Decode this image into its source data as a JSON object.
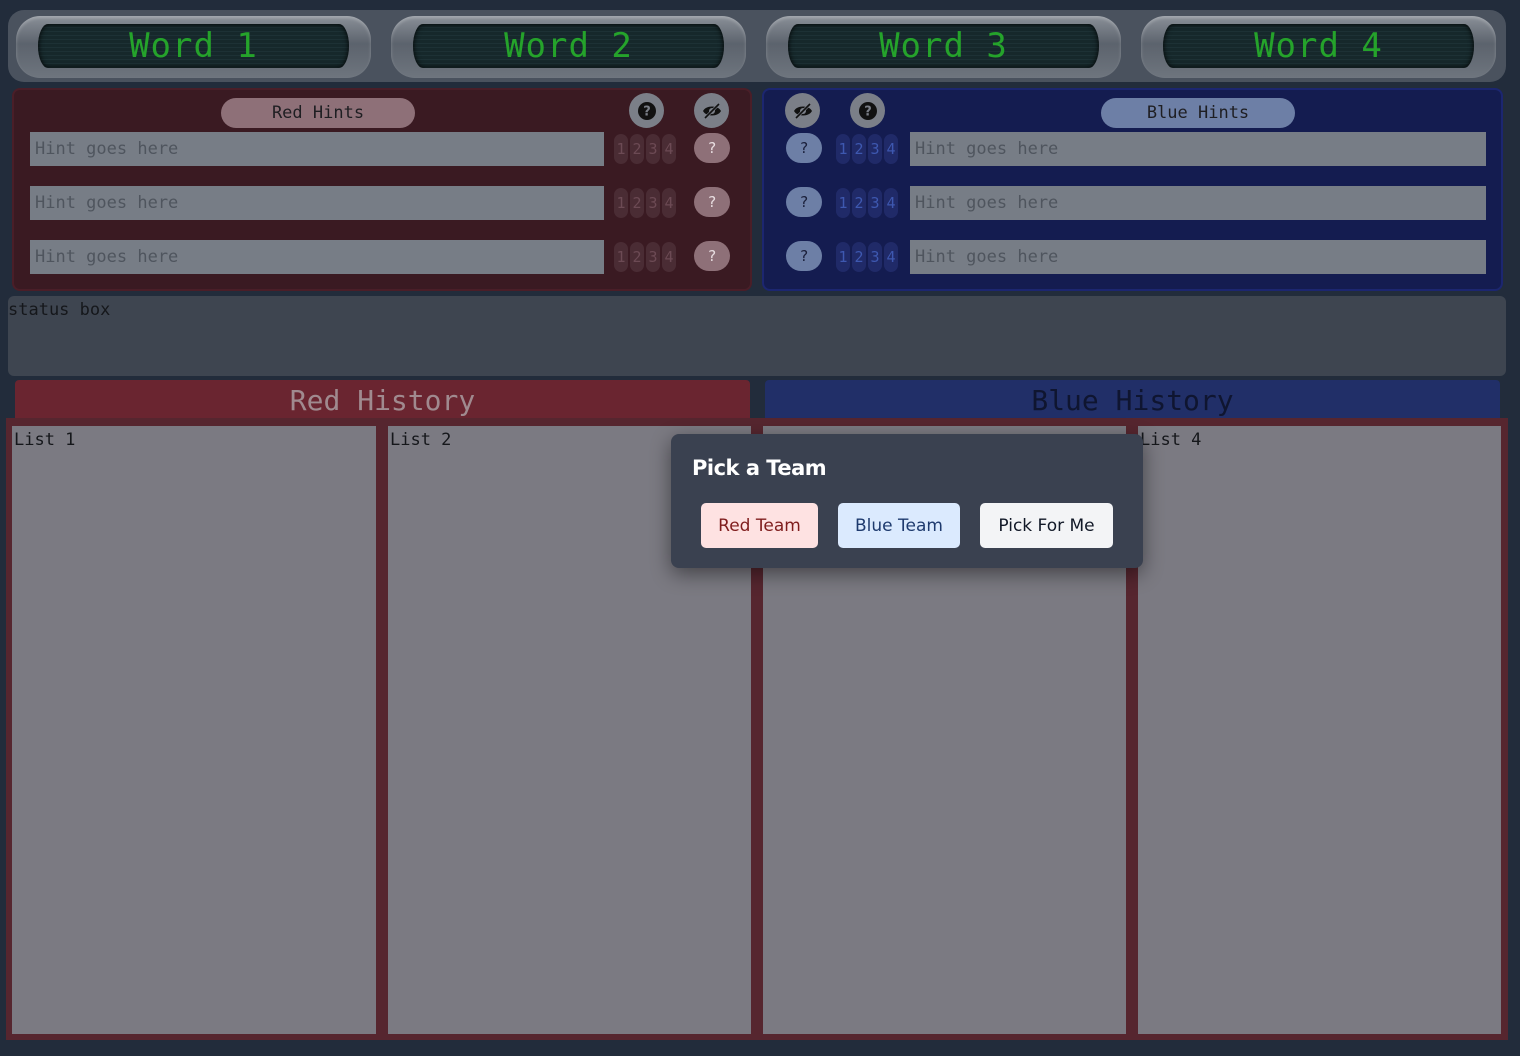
{
  "words": [
    "Word 1",
    "Word 2",
    "Word 3",
    "Word 4"
  ],
  "red_hints": {
    "title": "Red Hints",
    "icons": [
      "help-icon",
      "eye-off-icon"
    ],
    "placeholder": "Hint goes here",
    "numbers": [
      "1",
      "2",
      "3",
      "4"
    ],
    "guess_label": "?"
  },
  "blue_hints": {
    "title": "Blue Hints",
    "icons": [
      "eye-off-icon",
      "help-icon"
    ],
    "placeholder": "Hint goes here",
    "numbers": [
      "1",
      "2",
      "3",
      "4"
    ],
    "guess_label": "?"
  },
  "status": {
    "text": "status box"
  },
  "history": {
    "red_title": "Red History",
    "blue_title": "Blue History",
    "lists": [
      "List 1",
      "List 2",
      "",
      "List 4"
    ]
  },
  "modal": {
    "title": "Pick a Team",
    "red_button": "Red Team",
    "blue_button": "Blue Team",
    "pick_button": "Pick For Me"
  },
  "colors": {
    "red_accent": "#6a2530",
    "blue_accent": "#212f68",
    "word_text": "#25a32b",
    "background": "#222c3b"
  }
}
